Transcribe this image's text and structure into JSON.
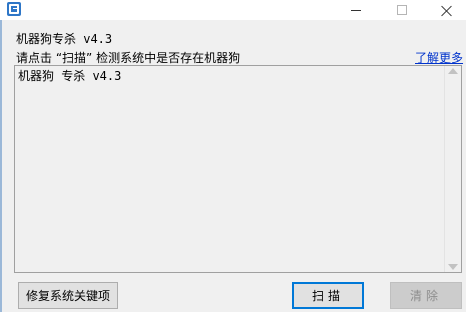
{
  "window": {
    "app_icon": "shield-app-icon"
  },
  "header": {
    "subtitle": "机器狗专杀 v4.3",
    "instruction": "请点击 “扫描” 检测系统中是否存在机器狗",
    "learn_more": "了解更多"
  },
  "output": {
    "text": "机器狗 专杀 v4.3"
  },
  "buttons": {
    "repair": "修复系统关键项",
    "scan": "扫描",
    "clear": "清除"
  },
  "colors": {
    "link": "#0033cc",
    "default_button_border": "#0078d7",
    "disabled_text": "#8d8d8d"
  }
}
